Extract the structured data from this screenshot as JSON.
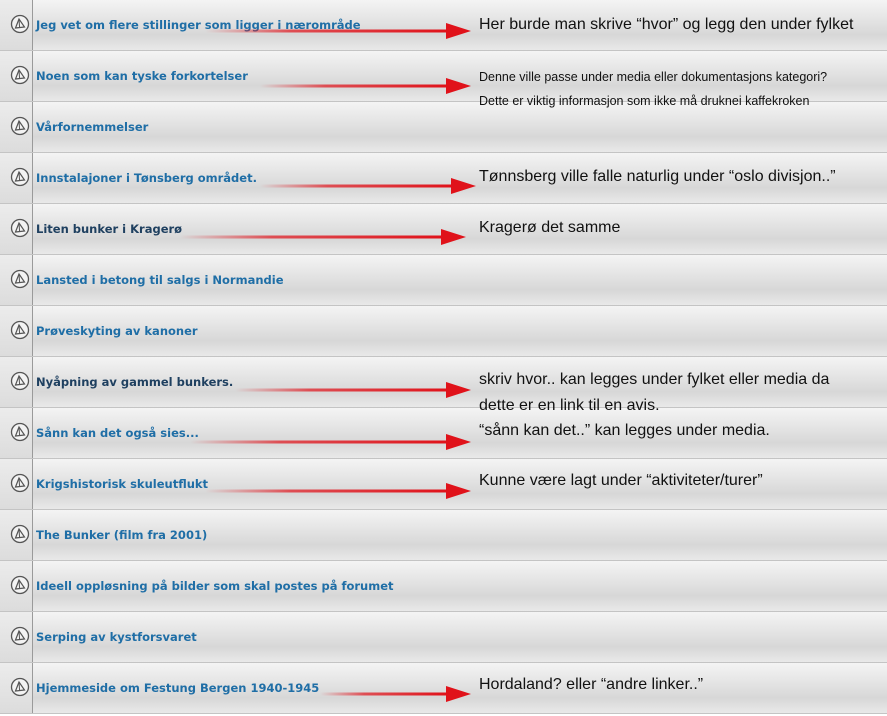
{
  "topics": [
    {
      "title": "Jeg vet om flere stillinger som ligger i nærområde",
      "icon": "topic-icon"
    },
    {
      "title": "Noen som kan tyske forkortelser",
      "icon": "topic-icon"
    },
    {
      "title": "Vårfornemmelser",
      "icon": "topic-icon"
    },
    {
      "title": "Innstalajoner i Tønsberg området.",
      "icon": "topic-icon"
    },
    {
      "title": "Liten bunker i Kragerø",
      "icon": "topic-icon"
    },
    {
      "title": "Lansted i betong til salgs i Normandie",
      "icon": "topic-icon"
    },
    {
      "title": "Prøveskyting av kanoner",
      "icon": "topic-icon"
    },
    {
      "title": "Nyåpning av gammel bunkers.",
      "icon": "topic-icon"
    },
    {
      "title": "Sånn kan det også sies...",
      "icon": "topic-icon"
    },
    {
      "title": "Krigshistorisk skuleutflukt",
      "icon": "topic-icon"
    },
    {
      "title": "The Bunker (film fra 2001)",
      "icon": "topic-icon"
    },
    {
      "title": "Ideell oppløsning på bilder som skal postes på forumet",
      "icon": "topic-icon"
    },
    {
      "title": "Serping av kystforsvaret",
      "icon": "topic-icon"
    },
    {
      "title": "Hjemmeside om Festung Bergen 1940-1945",
      "icon": "topic-icon"
    }
  ],
  "annotations": [
    "Her burde man skrive “hvor” og legg den under fylket",
    "Denne ville passe under media eller dokumentasjons kategori?",
    "Dette er viktig informasjon som ikke må druknei kaffekroken",
    "Tønnsberg ville falle naturlig under “oslo divisjon..”",
    "Kragerø det samme",
    "skriv hvor..  kan legges under fylket eller media da",
    "dette er en link til en avis.",
    "“sånn kan det..” kan legges under media.",
    "Kunne være lagt under “aktiviteter/turer”",
    "Hordaland? eller “andre linker..”"
  ],
  "colors": {
    "topic_link": "#1f6ea6",
    "arrow": "#e0121a",
    "annotation_text": "#111111"
  }
}
